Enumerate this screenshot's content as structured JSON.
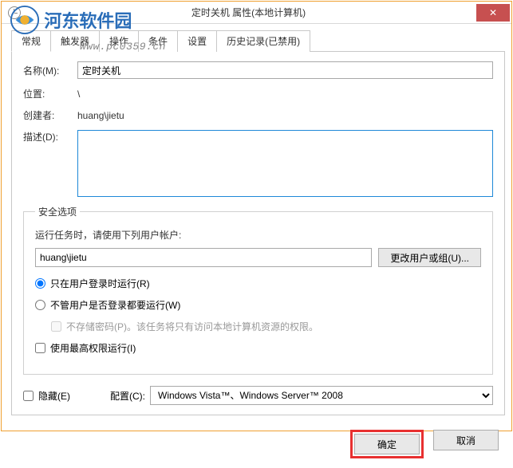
{
  "title": "定时关机 属性(本地计算机)",
  "watermark": {
    "brand": "河东软件园",
    "url": "www.pc0359.cn"
  },
  "tabs": {
    "general": "常规",
    "triggers": "触发器",
    "actions": "操作",
    "conditions": "条件",
    "settings": "设置",
    "history": "历史记录(已禁用)"
  },
  "general": {
    "name_label": "名称(M):",
    "name_value": "定时关机",
    "location_label": "位置:",
    "location_value": "\\",
    "creator_label": "创建者:",
    "creator_value": "huang\\jietu",
    "desc_label": "描述(D):",
    "desc_value": ""
  },
  "security": {
    "legend": "安全选项",
    "run_as_label": "运行任务时，请使用下列用户帐户:",
    "user_value": "huang\\jietu",
    "change_user_btn": "更改用户或组(U)...",
    "radio_logged_on": "只在用户登录时运行(R)",
    "radio_any_user": "不管用户是否登录都要运行(W)",
    "no_store_pwd": "不存储密码(P)。该任务将只有访问本地计算机资源的权限。",
    "highest_priv": "使用最高权限运行(I)"
  },
  "bottom": {
    "hidden_label": "隐藏(E)",
    "config_label": "配置(C):",
    "config_value": "Windows Vista™、Windows Server™ 2008"
  },
  "buttons": {
    "ok": "确定",
    "cancel": "取消"
  }
}
